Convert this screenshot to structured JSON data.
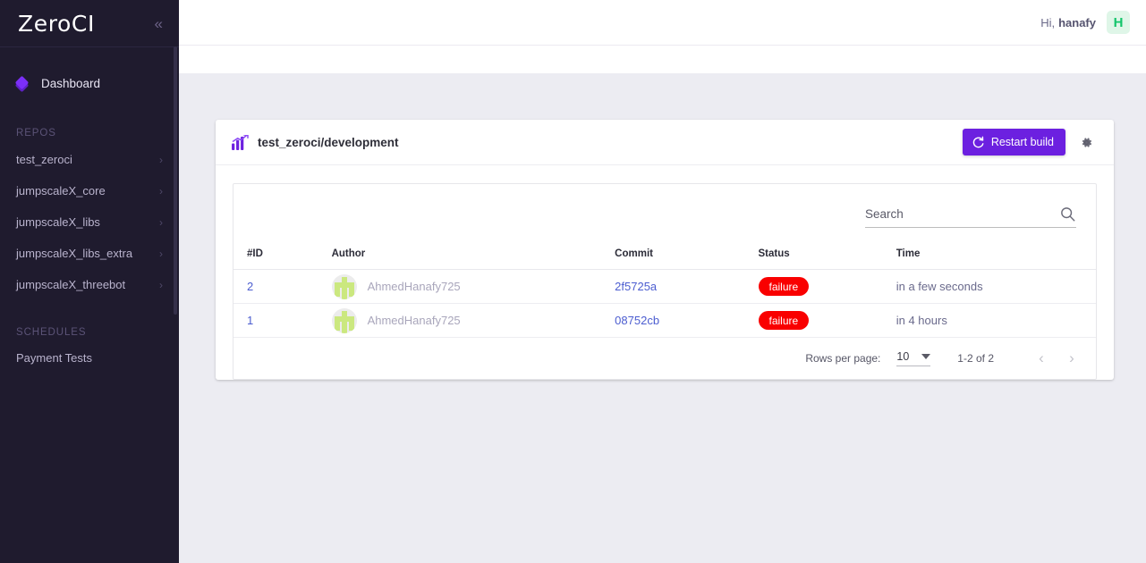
{
  "sidebar": {
    "logo": "ZeroCI",
    "collapse_icon": "chevron-double-left-icon",
    "dashboard": {
      "label": "Dashboard",
      "icon": "diamond-layers-icon"
    },
    "repos_label": "REPOS",
    "repos": [
      {
        "label": "test_zeroci"
      },
      {
        "label": "jumpscaleX_core"
      },
      {
        "label": "jumpscaleX_libs"
      },
      {
        "label": "jumpscaleX_libs_extra"
      },
      {
        "label": "jumpscaleX_threebot"
      }
    ],
    "schedules_label": "SCHEDULES",
    "schedules": [
      {
        "label": "Payment Tests"
      }
    ]
  },
  "topbar": {
    "greeting": "Hi,",
    "username": "hanafy",
    "avatar_initial": "H",
    "avatar_bg": "#dff6e8",
    "avatar_color": "#13c56b"
  },
  "card": {
    "title": "test_zeroci/development",
    "title_icon": "chart-trending-up-icon",
    "restart_label": "Restart build",
    "restart_icon": "refresh-icon",
    "restart_bg": "#6c20e0",
    "settings_icon": "gear-icon"
  },
  "search": {
    "placeholder": "Search",
    "value": "",
    "icon": "search-icon"
  },
  "table": {
    "columns": [
      "#ID",
      "Author",
      "Commit",
      "Status",
      "Time"
    ],
    "rows": [
      {
        "id": "2",
        "author": "AhmedHanafy725",
        "commit": "2f5725a",
        "status": "failure",
        "status_color": "#f90000",
        "time": "in a few seconds"
      },
      {
        "id": "1",
        "author": "AhmedHanafy725",
        "commit": "08752cb",
        "status": "failure",
        "status_color": "#f90000",
        "time": "in 4 hours"
      }
    ]
  },
  "pagination": {
    "rows_per_page_label": "Rows per page:",
    "rows_per_page_value": "10",
    "range": "1-2 of 2",
    "prev_icon": "chevron-left-icon",
    "next_icon": "chevron-right-icon"
  }
}
